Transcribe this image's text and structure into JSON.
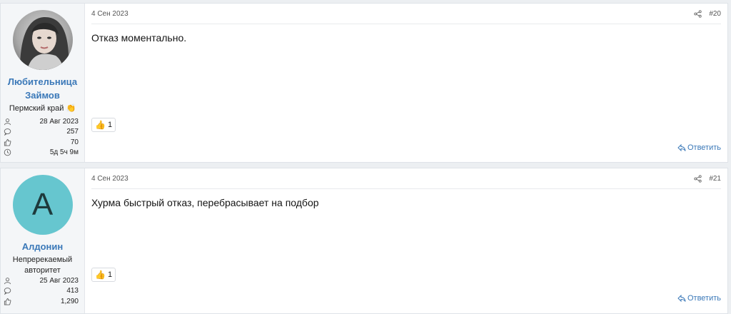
{
  "posts": [
    {
      "username": "Любительница Займов",
      "title": "Пермский край 👏",
      "stats": [
        "28 Авг 2023",
        "257",
        "70",
        "5д 5ч 9м"
      ],
      "date": "4 Сен 2023",
      "number": "#20",
      "message": "Отказ моментально.",
      "reaction_count": "1",
      "reply_label": "Ответить"
    },
    {
      "username": "Алдонин",
      "avatar_letter": "A",
      "title": "Непререкаемый авторитет",
      "stats": [
        "25 Авг 2023",
        "413",
        "1,290"
      ],
      "date": "4 Сен 2023",
      "number": "#21",
      "message": "Хурма быстрый отказ, перебрасывает на подбор",
      "reaction_count": "1",
      "reply_label": "Ответить"
    }
  ],
  "icons": [
    "user-icon",
    "comment-icon",
    "thumbs-up-icon",
    "clock-icon",
    "share-icon",
    "reply-icon"
  ],
  "colors": {
    "link": "#3a78b8",
    "avatar_bg": "#66c6cf",
    "sidebar_bg": "#f4f6f8"
  }
}
